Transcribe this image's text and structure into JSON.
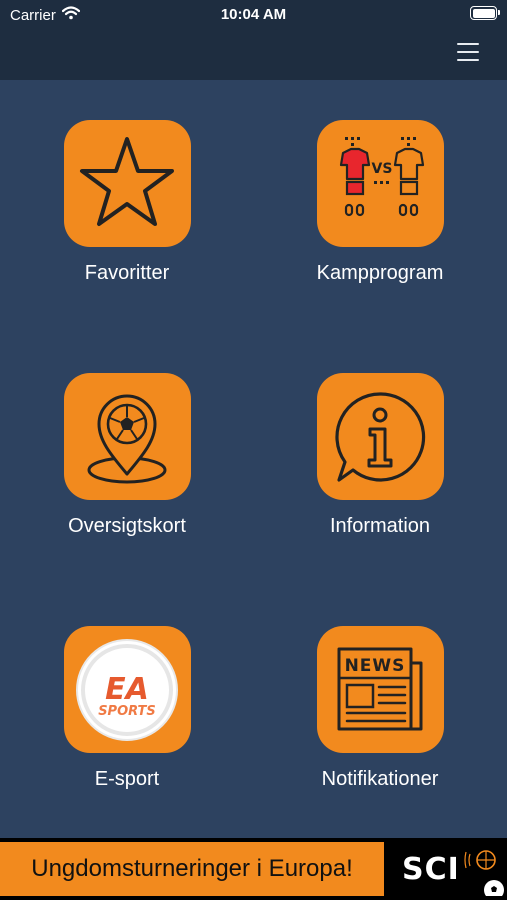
{
  "status_bar": {
    "carrier": "Carrier",
    "time": "10:04 AM",
    "battery_level": 1.0
  },
  "navbar": {
    "menu_icon": "hamburger-menu-icon"
  },
  "tiles": [
    {
      "label": "Favoritter",
      "icon": "star-icon"
    },
    {
      "label": "Kampprogram",
      "icon": "match-jerseys-vs-icon"
    },
    {
      "label": "Oversigtskort",
      "icon": "map-pin-football-icon"
    },
    {
      "label": "Information",
      "icon": "info-bubble-icon"
    },
    {
      "label": "E-sport",
      "icon": "ea-sports-logo-icon"
    },
    {
      "label": "Notifikationer",
      "icon": "newspaper-icon"
    }
  ],
  "icon_texts": {
    "ea_top": "EA",
    "ea_bottom": "SPORTS",
    "news": "NEWS"
  },
  "banner": {
    "text": "Ungdomsturneringer i Europa!",
    "logo_text": "SCI"
  },
  "colors": {
    "background": "#2d4260",
    "bars": "#1e2d40",
    "accent": "#f28a1e",
    "jersey_red": "#e8262d",
    "icon_stroke": "#222222"
  }
}
